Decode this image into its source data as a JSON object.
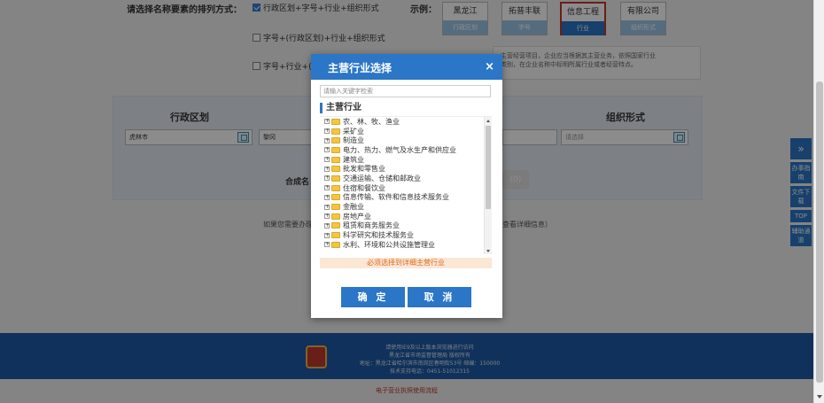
{
  "order": {
    "label": "请选择名称要素的排列方式：",
    "options": [
      {
        "text": "行政区划+字号+行业+组织形式",
        "checked": true
      },
      {
        "text": "字号+(行政区划)+行业+组织形式",
        "checked": false
      },
      {
        "text": "字号+行业+(",
        "checked": false
      }
    ]
  },
  "example": {
    "label": "示例：",
    "boxes": [
      {
        "top": "黑龙江",
        "bottom": "行政区划"
      },
      {
        "top": "拓普丰联",
        "bottom": "字号"
      },
      {
        "top": "信息工程",
        "bottom": "行业"
      },
      {
        "top": "有限公司",
        "bottom": "组织形式"
      }
    ]
  },
  "notice": {
    "line1": "主营经营项目，企业应当根据其主营业务，依照国家行业",
    "line2": "类别，在企业名称中标明所属行业或者经营特点。"
  },
  "form": {
    "col_admin": "行政区划",
    "col_org": "组织形式",
    "admin_value": "虎林市",
    "name_value": "黎冈",
    "org_placeholder": "请选择",
    "combo_label": "合成名",
    "gray_btn": "(0)",
    "info_left": "如果您需要办理",
    "info_right": "查看详细信息）"
  },
  "footer": {
    "line1": "请使用IE9及以上版本浏览器进行访问",
    "line2": "黑龙江省市场监督管理局 版权所有",
    "line3": "地址：黑龙江省哈尔滨市南岗区春明街53号 邮编：150000",
    "line4": "技术支持电话：0451-51012315",
    "bottom_link": "电子营业执照使用流程"
  },
  "side_tools": [
    "办事指南",
    "文件下载",
    "TOP",
    "辅助通道"
  ],
  "modal": {
    "title": "主营行业选择",
    "close": "×",
    "search_placeholder": "请输入关键字检索",
    "section": "主营行业",
    "tree": [
      "农、林、牧、渔业",
      "采矿业",
      "制造业",
      "电力、热力、燃气及水生产和供应业",
      "建筑业",
      "批发和零售业",
      "交通运输、仓储和邮政业",
      "住宿和餐饮业",
      "信息传输、软件和信息技术服务业",
      "金融业",
      "房地产业",
      "租赁和商务服务业",
      "科学研究和技术服务业",
      "水利、环境和公共设施管理业"
    ],
    "hint": "必须选择到详细主营行业",
    "confirm": "确 定",
    "cancel": "取 消"
  },
  "colors": {
    "primary": "#2b76c6",
    "hint_text": "#e06a1b",
    "hint_bg": "#fbe7d6",
    "footer_bg": "#1e5aa6"
  }
}
